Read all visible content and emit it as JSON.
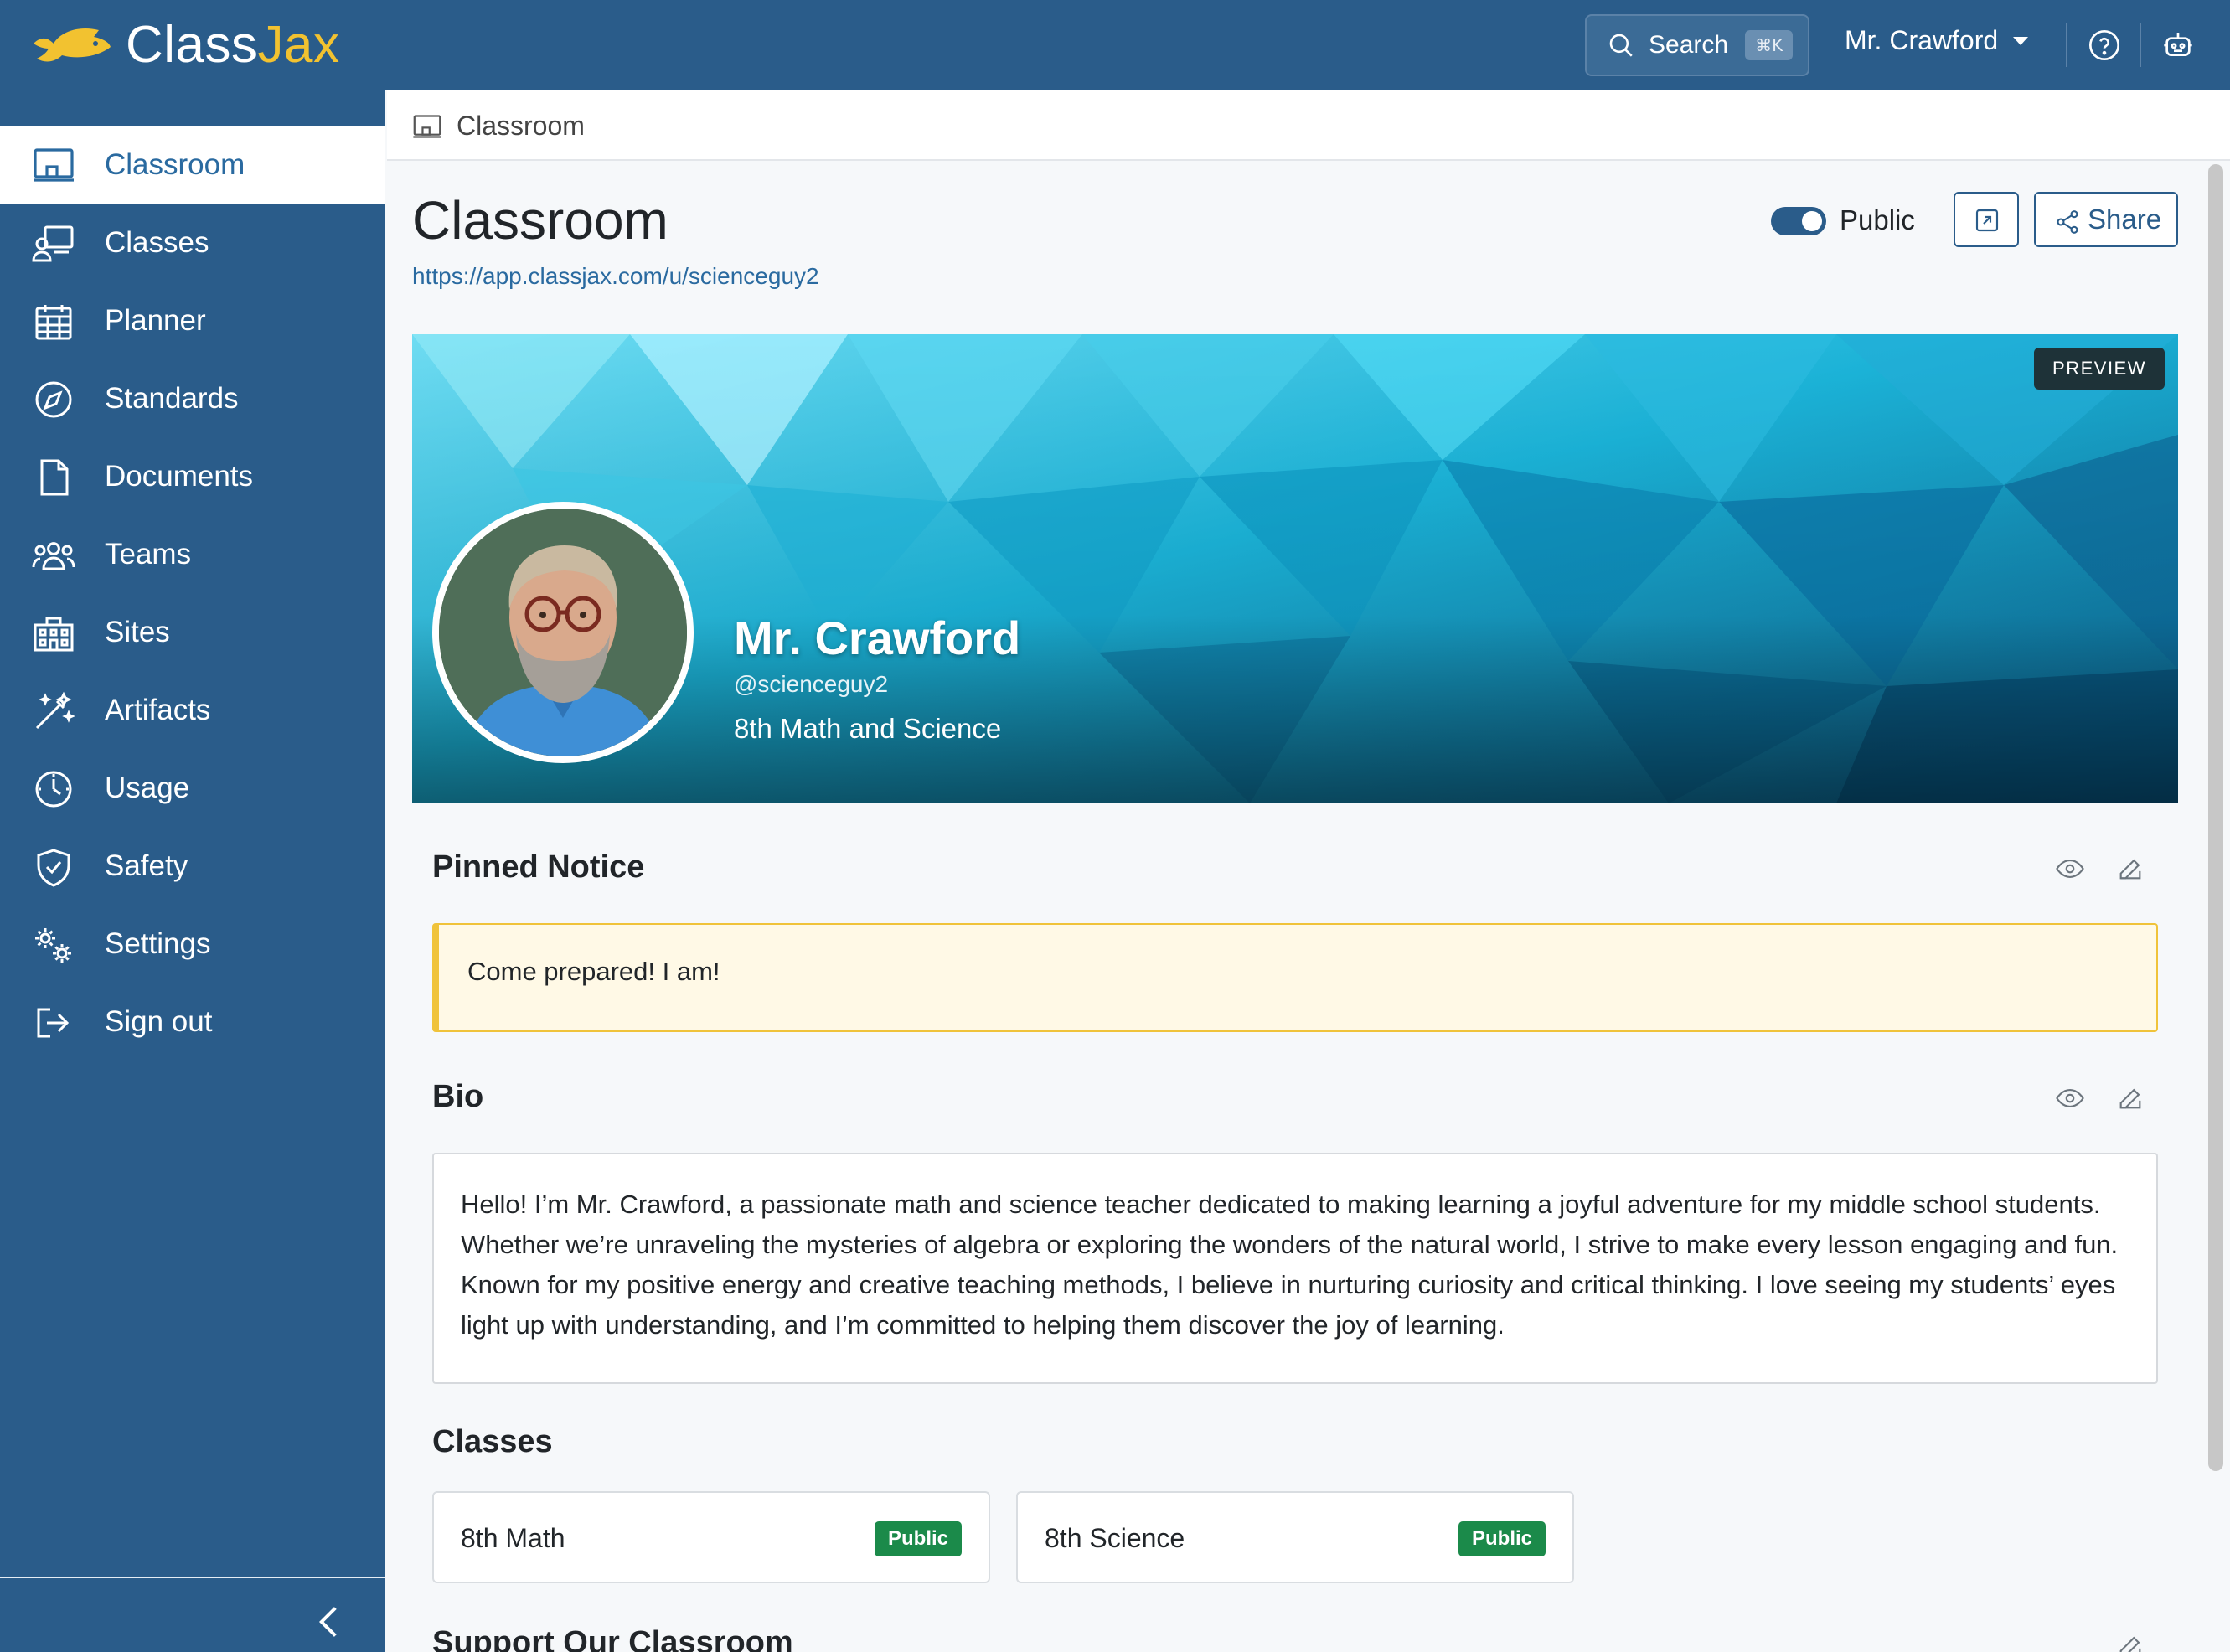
{
  "app": {
    "brand_part1": "Class",
    "brand_part2": "Jax",
    "brand_color": "#2a5c8a",
    "accent_color": "#f2c230"
  },
  "topbar": {
    "search_label": "Search",
    "search_shortcut": "⌘K",
    "user_name": "Mr. Crawford",
    "help_icon": "help-circle-icon",
    "bot_icon": "robot-icon"
  },
  "sidebar": {
    "items": [
      {
        "label": "Classroom",
        "icon": "classroom-icon",
        "active": true
      },
      {
        "label": "Classes",
        "icon": "classes-icon"
      },
      {
        "label": "Planner",
        "icon": "calendar-icon"
      },
      {
        "label": "Standards",
        "icon": "compass-icon"
      },
      {
        "label": "Documents",
        "icon": "document-icon"
      },
      {
        "label": "Teams",
        "icon": "teams-icon"
      },
      {
        "label": "Sites",
        "icon": "building-icon"
      },
      {
        "label": "Artifacts",
        "icon": "magic-wand-icon"
      },
      {
        "label": "Usage",
        "icon": "gauge-icon"
      },
      {
        "label": "Safety",
        "icon": "shield-check-icon"
      },
      {
        "label": "Settings",
        "icon": "gears-icon"
      },
      {
        "label": "Sign out",
        "icon": "sign-out-icon"
      }
    ]
  },
  "breadcrumb": {
    "label": "Classroom"
  },
  "page": {
    "title": "Classroom",
    "url": "https://app.classjax.com/u/scienceguy2",
    "visibility_label": "Public",
    "visibility_on": true,
    "share_label": "Share"
  },
  "banner": {
    "badge": "PREVIEW",
    "name": "Mr. Crawford",
    "handle": "@scienceguy2",
    "subject": "8th Math and Science"
  },
  "pinned_notice": {
    "title": "Pinned Notice",
    "text": "Come prepared! I am!"
  },
  "bio": {
    "title": "Bio",
    "text": "Hello! I’m Mr. Crawford, a passionate math and science teacher dedicated to making learning a joyful adventure for my middle school students. Whether we’re unraveling the mysteries of algebra or exploring the wonders of the natural world, I strive to make every lesson engaging and fun. Known for my positive energy and creative teaching methods, I believe in nurturing curiosity and critical thinking. I love seeing my students’ eyes light up with understanding, and I’m committed to helping them discover the joy of learning."
  },
  "classes": {
    "title": "Classes",
    "items": [
      {
        "name": "8th Math",
        "badge": "Public"
      },
      {
        "name": "8th Science",
        "badge": "Public"
      }
    ]
  },
  "support": {
    "title": "Support Our Classroom"
  }
}
